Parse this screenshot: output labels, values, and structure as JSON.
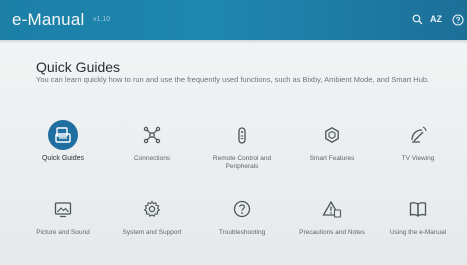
{
  "header": {
    "title": "e-Manual",
    "version": "v1.10",
    "icons": [
      "search-icon",
      "az-icon",
      "help-icon"
    ],
    "az_label": "AZ"
  },
  "section": {
    "title": "Quick Guides",
    "description": "You can learn quickly how to run and use the frequently used functions, such as Bixby, Ambient Mode, and Smart Hub."
  },
  "tiles": [
    {
      "label": "Quick Guides",
      "icon": "quick-guides-icon",
      "selected": true
    },
    {
      "label": "Connections",
      "icon": "connections-icon",
      "selected": false
    },
    {
      "label": "Remote Control and Peripherals",
      "icon": "remote-control-icon",
      "selected": false
    },
    {
      "label": "Smart Features",
      "icon": "smart-features-icon",
      "selected": false
    },
    {
      "label": "TV Viewing",
      "icon": "tv-viewing-icon",
      "selected": false
    },
    {
      "label": "Picture and Sound",
      "icon": "picture-sound-icon",
      "selected": false
    },
    {
      "label": "System and Support",
      "icon": "system-support-icon",
      "selected": false
    },
    {
      "label": "Troubleshooting",
      "icon": "troubleshooting-icon",
      "selected": false
    },
    {
      "label": "Precautions and Notes",
      "icon": "precautions-icon",
      "selected": false
    },
    {
      "label": "Using the e-Manual",
      "icon": "using-manual-icon",
      "selected": false
    }
  ],
  "colors": {
    "accent": "#1e88b0",
    "selected_icon_bg": "#1f6fa0",
    "icon_stroke": "#4b555b"
  }
}
